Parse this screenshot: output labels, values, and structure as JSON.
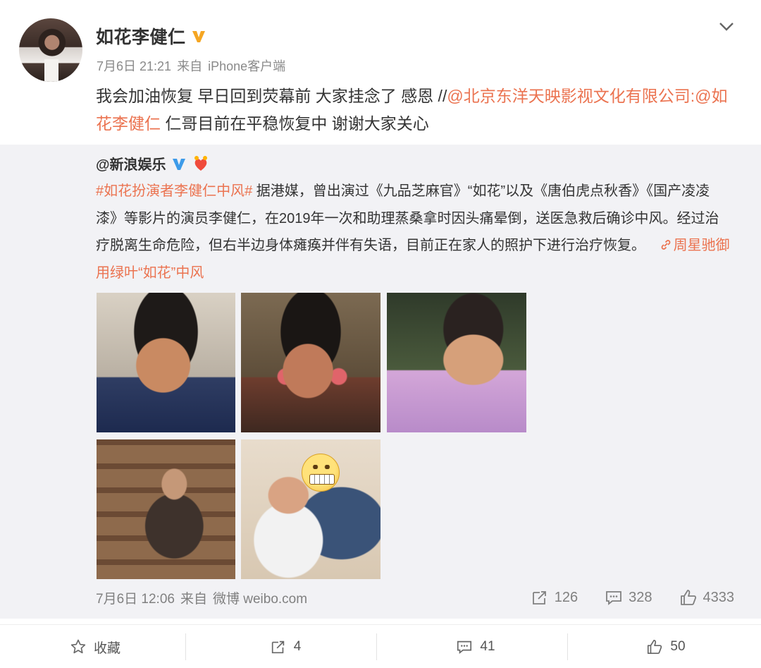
{
  "post": {
    "username": "如花李健仁",
    "time": "7月6日 21:21",
    "source_prefix": "来自",
    "source": "iPhone客户端",
    "text_main": "我会加油恢复 早日回到荧幕前 大家挂念了 感恩 //",
    "mention_1": "@北京东洋天映影视文化有限公司",
    "text_sep": ":",
    "mention_2": "@如花李健仁",
    "text_tail": " 仁哥目前在平稳恢复中 谢谢大家关心"
  },
  "repost": {
    "author": "@新浪娱乐",
    "hashtag": "#如花扮演者李健仁中风#",
    "text": " 据港媒，曾出演过《九品芝麻官》“如花”以及《唐伯虎点秋香》《国产凌凌漆》等影片的演员李健仁，在2019年一次和助理蒸桑拿时因头痛晕倒，送医急救后确诊中风。经过治疗脱离生命危险，但右半边身体瘫痪并伴有失语，目前正在家人的照护下进行治疗恢复。",
    "link_text": "周星驰御用绿叶“如花”中风",
    "time": "7月6日 12:06",
    "source_prefix": "来自",
    "source": "微博 weibo.com",
    "reposts": "126",
    "comments": "328",
    "likes": "4333"
  },
  "actions": {
    "favorite": "收藏",
    "repost": "4",
    "comment": "41",
    "like": "50"
  },
  "colors": {
    "accent": "#eb7350",
    "verified": "#f5a623",
    "verified_blue": "#3d9be9",
    "repost_bg": "#f2f2f5"
  },
  "icons": [
    "chevron-down-icon",
    "verified-icon",
    "repost-icon",
    "comment-icon",
    "like-icon",
    "star-icon",
    "link-icon"
  ]
}
